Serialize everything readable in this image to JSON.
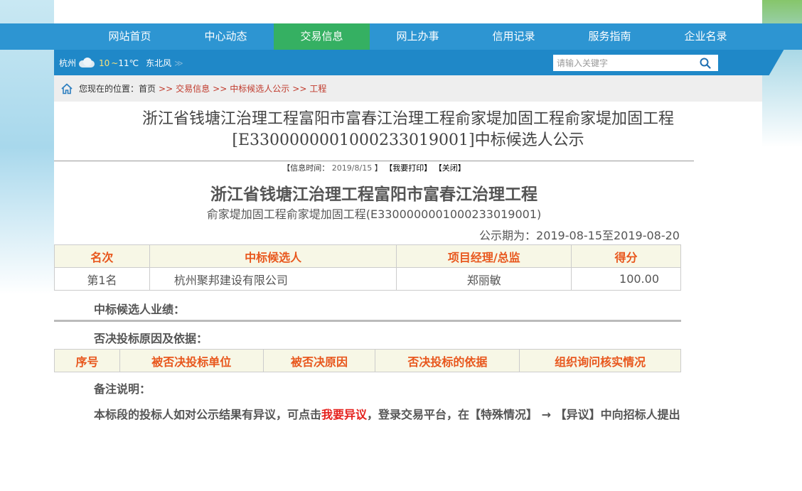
{
  "nav": {
    "items": [
      {
        "label": "网站首页",
        "active": false
      },
      {
        "label": "中心动态",
        "active": false
      },
      {
        "label": "交易信息",
        "active": true
      },
      {
        "label": "网上办事",
        "active": false
      },
      {
        "label": "信用记录",
        "active": false
      },
      {
        "label": "服务指南",
        "active": false
      },
      {
        "label": "企业名录",
        "active": false
      }
    ]
  },
  "weather": {
    "city": "杭州",
    "temp_low": "10",
    "tilde": "~",
    "temp_high": "11℃",
    "wind": "东北风",
    "arrow": "≫"
  },
  "search": {
    "placeholder": "请输入关键字"
  },
  "breadcrumb": {
    "prefix": "您现在的位置：",
    "home": "首页",
    "sep": ">>",
    "items": [
      "交易信息",
      "中标候选人公示",
      "工程"
    ]
  },
  "page": {
    "heading_line1": "浙江省钱塘江治理工程富阳市富春江治理工程俞家堤加固工程俞家堤加固工程",
    "heading_line2": "[E3300000001000233019001]中标候选人公示"
  },
  "meta": {
    "open": "【信息时间：",
    "date": "2019/8/15",
    "close": "】",
    "print": "【我要打印】",
    "close_btn": "【关闭】"
  },
  "doc": {
    "title": "浙江省钱塘江治理工程富阳市富春江治理工程",
    "subtitle": "俞家堤加固工程俞家堤加固工程(E3300000001000233019001)",
    "period": "公示期为：2019-08-15至2019-08-20"
  },
  "candidates": {
    "headers": [
      "名次",
      "中标候选人",
      "项目经理/总监",
      "得分"
    ],
    "rows": [
      {
        "rank": "第1名",
        "name": "杭州聚邦建设有限公司",
        "manager": "郑丽敏",
        "score": "100.00"
      }
    ]
  },
  "sections": {
    "performance": "中标候选人业绩：",
    "reject": "否决投标原因及依据："
  },
  "reject_table": {
    "headers": [
      "序号",
      "被否决投标单位",
      "被否决原因",
      "否决投标的依据",
      "组织询问核实情况"
    ]
  },
  "remarks": {
    "title": "备注说明：",
    "text_before": "本标段的投标人如对公示结果有异议，可点击",
    "link": "我要异议",
    "text_after": "，登录交易平台，在【特殊情况】 → 【异议】中向招标人提出"
  }
}
